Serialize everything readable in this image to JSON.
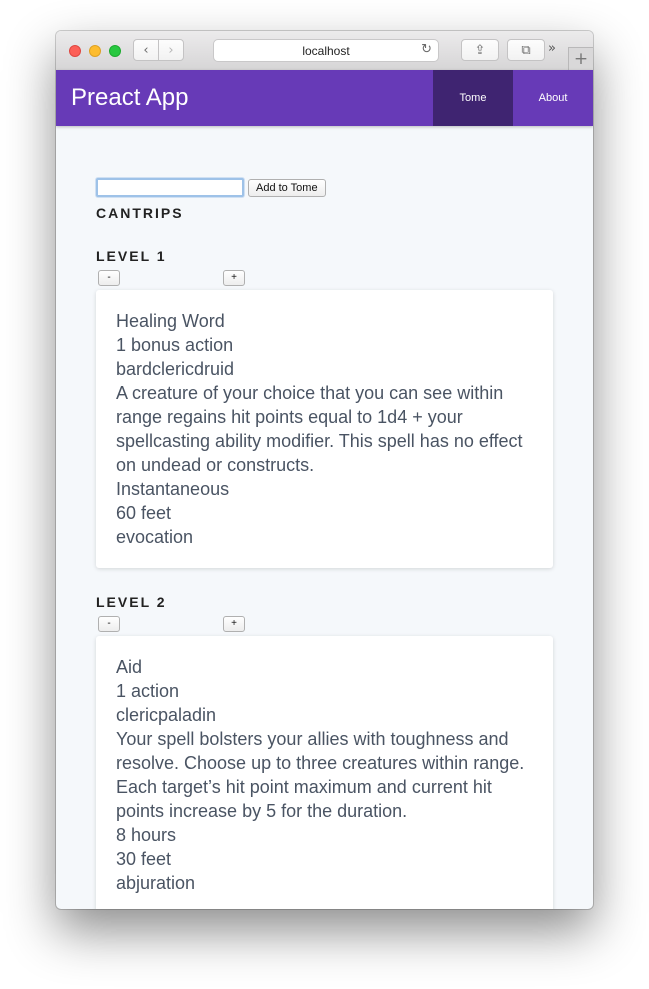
{
  "browser": {
    "url": "localhost",
    "back_glyph": "‹",
    "forward_glyph": "›",
    "reload_glyph": "↻",
    "share_glyph": "⇪",
    "tabs_glyph": "⧉",
    "more_glyph": "»",
    "newtab_glyph": "+"
  },
  "header": {
    "title": "Preact App",
    "nav": [
      {
        "label": "Tome",
        "active": true
      },
      {
        "label": "About",
        "active": false
      }
    ],
    "accent": "#673ab7"
  },
  "form": {
    "input_value": "",
    "button_label": "Add to Tome"
  },
  "sections": [
    {
      "heading": "CANTRIPS"
    },
    {
      "heading": "LEVEL 1",
      "minus_label": "-",
      "plus_label": "+",
      "spell": {
        "name": "Healing Word",
        "casting_time": "1 bonus action",
        "classes": "bardclericdruid",
        "description": "A creature of your choice that you can see within range regains hit points equal to 1d4 + your spellcasting ability modifier. This spell has no effect on undead or constructs.",
        "duration": "Instantaneous",
        "range": "60 feet",
        "school": "evocation"
      }
    },
    {
      "heading": "LEVEL 2",
      "minus_label": "-",
      "plus_label": "+",
      "spell": {
        "name": "Aid",
        "casting_time": "1 action",
        "classes": "clericpaladin",
        "description": "Your spell bolsters your allies with toughness and resolve. Choose up to three creatures within range. Each target’s hit point maximum and current hit points increase by 5 for the duration.",
        "duration": "8 hours",
        "range": "30 feet",
        "school": "abjuration"
      }
    }
  ]
}
